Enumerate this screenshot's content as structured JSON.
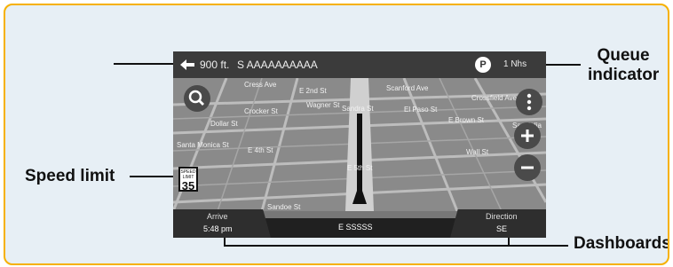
{
  "callouts": {
    "queue_indicator_line1": "Queue",
    "queue_indicator_line2": "indicator",
    "speed_limit": "Speed limit",
    "dashboards": "Dashboards"
  },
  "nav": {
    "distance": "900 ft.",
    "street": "S AAAAAAAAAA",
    "parking_badge": "P",
    "queue_value": "1 Nhs",
    "speed_sign_label": "SPEED LIMIT",
    "speed_sign_value": "35",
    "map_labels": [
      "Cress Ave",
      "E 2nd St",
      "Scanford Ave",
      "Crossfield Ave",
      "Crocker St",
      "Wagner St",
      "El Paso St",
      "E Brown St",
      "Dollar St",
      "Santa Monica St",
      "Sandra St",
      "E 4th St",
      "E 5th St",
      "Wall St",
      "Sandoe St",
      "San Julia"
    ],
    "bottom": {
      "left_label": "Arrive",
      "left_value": "5:48 pm",
      "center_value": "E SSSSS",
      "right_label": "Direction",
      "right_value": "SE"
    }
  },
  "icons": [
    "turn-arrow-icon",
    "search-icon",
    "more-icon",
    "zoom-in-icon",
    "zoom-out-icon",
    "parking-icon",
    "nav-arrow-icon"
  ],
  "colors": {
    "frame_border": "#f6b100",
    "background": "#e7eff5"
  }
}
